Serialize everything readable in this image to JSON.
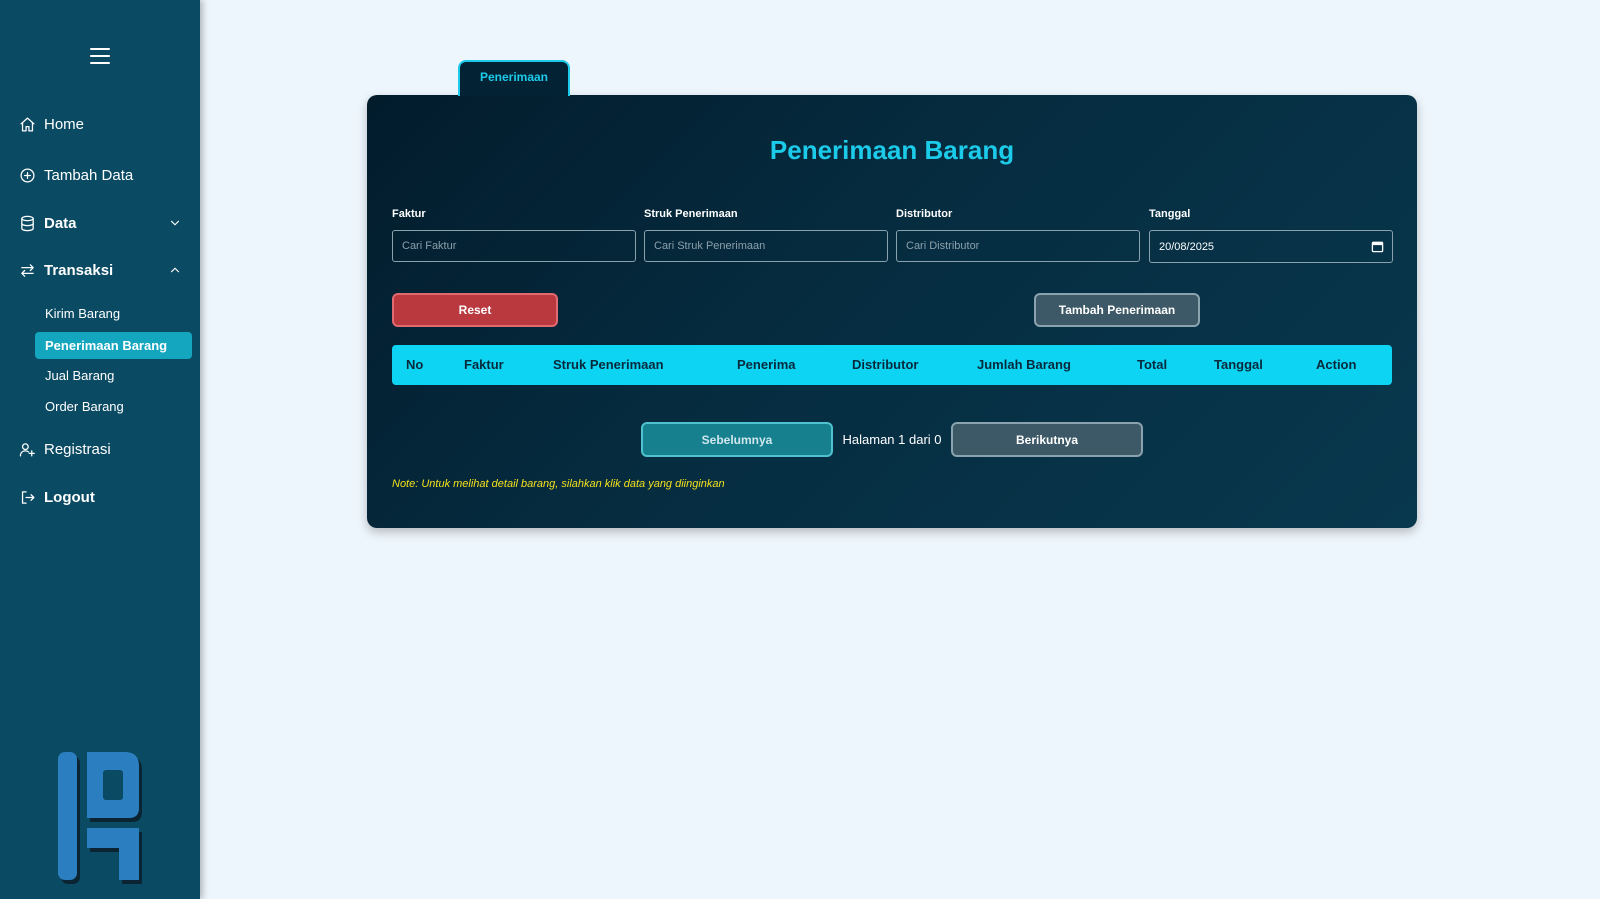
{
  "sidebar": {
    "menu_icon": "hamburger-icon",
    "items": [
      {
        "label": "Home",
        "icon": "home-icon"
      },
      {
        "label": "Tambah Data",
        "icon": "plus-circle-icon"
      },
      {
        "label": "Data",
        "icon": "database-icon",
        "chevron": "chevron-down-icon"
      },
      {
        "label": "Transaksi",
        "icon": "arrows-exchange-icon",
        "chevron": "chevron-up-icon"
      },
      {
        "label": "Registrasi",
        "icon": "user-add-icon"
      },
      {
        "label": "Logout",
        "icon": "logout-icon"
      }
    ],
    "sub_items": [
      {
        "label": "Kirim Barang",
        "active": false
      },
      {
        "label": "Penerimaan Barang",
        "active": true
      },
      {
        "label": "Jual Barang",
        "active": false
      },
      {
        "label": "Order Barang",
        "active": false
      }
    ]
  },
  "tab": {
    "label": "Penerimaan"
  },
  "main": {
    "title": "Penerimaan Barang",
    "filters": {
      "faktur": {
        "label": "Faktur",
        "placeholder": "Cari Faktur",
        "value": ""
      },
      "struk": {
        "label": "Struk Penerimaan",
        "placeholder": "Cari Struk Penerimaan",
        "value": ""
      },
      "distributor": {
        "label": "Distributor",
        "placeholder": "Cari Distributor",
        "value": ""
      },
      "tanggal": {
        "label": "Tanggal",
        "value": "20/08/2025",
        "icon": "calendar-icon"
      }
    },
    "buttons": {
      "reset": "Reset",
      "tambah": "Tambah Penerimaan",
      "prev": "Sebelumnya",
      "next": "Berikutnya"
    },
    "table": {
      "columns": [
        "No",
        "Faktur",
        "Struk Penerimaan",
        "Penerima",
        "Distributor",
        "Jumlah Barang",
        "Total",
        "Tanggal",
        "Action"
      ],
      "rows": []
    },
    "pagination": {
      "text": "Halaman 1 dari 0"
    },
    "note": "Note: Untuk melihat detail barang, silahkan klik data yang diinginkan"
  },
  "colors": {
    "sidebar_bg": "#0b4a63",
    "accent": "#1ccbe9",
    "table_header": "#0ed4f3",
    "reset_button": "#b9393f",
    "active_sub_item": "#14a6bf",
    "note_text": "#f2e21c",
    "page_bg": "#eef6fd"
  }
}
